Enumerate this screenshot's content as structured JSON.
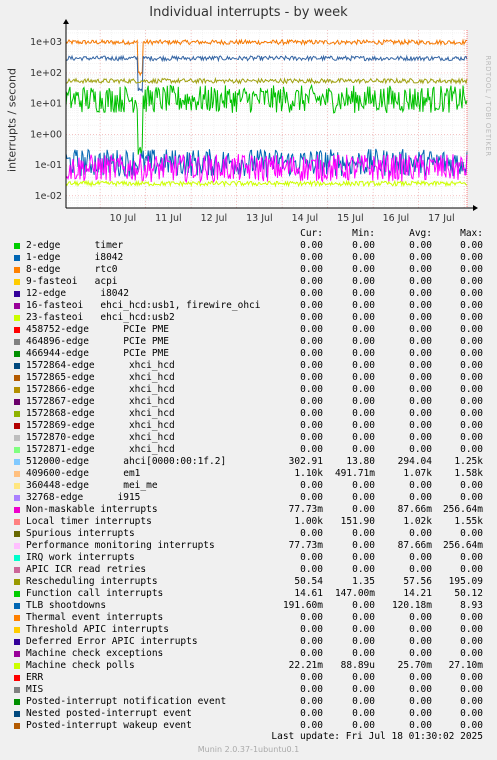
{
  "chart_data": {
    "type": "line",
    "title": "Individual interrupts - by week",
    "ylabel": "interrupts / second",
    "yscale": "log",
    "ylim": [
      0.004,
      2500
    ],
    "yticks": [
      "1e+03",
      "1e+02",
      "1e+01",
      "1e+00",
      "1e-01",
      "1e-02"
    ],
    "ytick_values": [
      1000,
      100,
      10,
      1,
      0.1,
      0.01
    ],
    "xticks": [
      "10 Jul",
      "11 Jul",
      "12 Jul",
      "13 Jul",
      "14 Jul",
      "15 Jul",
      "16 Jul",
      "17 Jul"
    ],
    "xlim": [
      "2025-07-09 06:00",
      "2025-07-18 01:30"
    ],
    "grid": true,
    "series": [
      {
        "name": "Local timer interrupts",
        "color": "#f57900",
        "approx_level": 1000,
        "gap_start": "2025-07-10 20:00",
        "gap_end": "2025-07-10 22:30",
        "gap_level": 100
      },
      {
        "name": "512000-edge ahci[0000:00:1f.2]",
        "color": "#3465a4",
        "approx_level": 300,
        "gap_start": "2025-07-10 20:00",
        "gap_end": "2025-07-10 22:30",
        "gap_level": 30
      },
      {
        "name": "Rescheduling interrupts",
        "color": "#a0a010",
        "approx_level": 55
      },
      {
        "name": "Function call interrupts",
        "color": "#00c000",
        "approx_level": 14,
        "dip_level": 0.4
      },
      {
        "name": "TLB shootdowns",
        "color": "#0066b3",
        "approx_level": 0.12
      },
      {
        "name": "Non-maskable interrupts",
        "color": "#ff00ff",
        "approx_level": 0.08
      },
      {
        "name": "Machine check polls",
        "color": "#ccff00",
        "approx_level": 0.025
      }
    ]
  },
  "side_note": "RRDTOOL / TOBI OETIKER",
  "legend": {
    "headers": [
      "Cur:",
      "Min:",
      "Avg:",
      "Max:"
    ],
    "rows": [
      {
        "label": "2-edge      timer",
        "color": "#00cc00",
        "cur": "0.00",
        "min": "0.00",
        "avg": "0.00",
        "max": "0.00"
      },
      {
        "label": "1-edge      i8042",
        "color": "#0066b3",
        "cur": "0.00",
        "min": "0.00",
        "avg": "0.00",
        "max": "0.00"
      },
      {
        "label": "8-edge      rtc0",
        "color": "#ff8000",
        "cur": "0.00",
        "min": "0.00",
        "avg": "0.00",
        "max": "0.00"
      },
      {
        "label": "9-fasteoi   acpi",
        "color": "#ffcc00",
        "cur": "0.00",
        "min": "0.00",
        "avg": "0.00",
        "max": "0.00"
      },
      {
        "label": "12-edge      i8042",
        "color": "#330099",
        "cur": "0.00",
        "min": "0.00",
        "avg": "0.00",
        "max": "0.00"
      },
      {
        "label": "16-fasteoi   ehci_hcd:usb1, firewire_ohci",
        "color": "#990099",
        "cur": "0.00",
        "min": "0.00",
        "avg": "0.00",
        "max": "0.00"
      },
      {
        "label": "23-fasteoi   ehci_hcd:usb2",
        "color": "#ccff00",
        "cur": "0.00",
        "min": "0.00",
        "avg": "0.00",
        "max": "0.00"
      },
      {
        "label": "458752-edge      PCIe PME",
        "color": "#ff0000",
        "cur": "0.00",
        "min": "0.00",
        "avg": "0.00",
        "max": "0.00"
      },
      {
        "label": "464896-edge      PCIe PME",
        "color": "#808080",
        "cur": "0.00",
        "min": "0.00",
        "avg": "0.00",
        "max": "0.00"
      },
      {
        "label": "466944-edge      PCIe PME",
        "color": "#008f00",
        "cur": "0.00",
        "min": "0.00",
        "avg": "0.00",
        "max": "0.00"
      },
      {
        "label": "1572864-edge      xhci_hcd",
        "color": "#00487d",
        "cur": "0.00",
        "min": "0.00",
        "avg": "0.00",
        "max": "0.00"
      },
      {
        "label": "1572865-edge      xhci_hcd",
        "color": "#b35a00",
        "cur": "0.00",
        "min": "0.00",
        "avg": "0.00",
        "max": "0.00"
      },
      {
        "label": "1572866-edge      xhci_hcd",
        "color": "#b38f00",
        "cur": "0.00",
        "min": "0.00",
        "avg": "0.00",
        "max": "0.00"
      },
      {
        "label": "1572867-edge      xhci_hcd",
        "color": "#6b006b",
        "cur": "0.00",
        "min": "0.00",
        "avg": "0.00",
        "max": "0.00"
      },
      {
        "label": "1572868-edge      xhci_hcd",
        "color": "#8fb300",
        "cur": "0.00",
        "min": "0.00",
        "avg": "0.00",
        "max": "0.00"
      },
      {
        "label": "1572869-edge      xhci_hcd",
        "color": "#b30000",
        "cur": "0.00",
        "min": "0.00",
        "avg": "0.00",
        "max": "0.00"
      },
      {
        "label": "1572870-edge      xhci_hcd",
        "color": "#bebebe",
        "cur": "0.00",
        "min": "0.00",
        "avg": "0.00",
        "max": "0.00"
      },
      {
        "label": "1572871-edge      xhci_hcd",
        "color": "#80ff80",
        "cur": "0.00",
        "min": "0.00",
        "avg": "0.00",
        "max": "0.00"
      },
      {
        "label": "512000-edge      ahci[0000:00:1f.2]",
        "color": "#80c9ff",
        "cur": "302.91",
        "min": "13.80",
        "avg": "294.04",
        "max": "1.25k"
      },
      {
        "label": "409600-edge      em1",
        "color": "#ffc080",
        "cur": "1.10k",
        "min": "491.71m",
        "avg": "1.07k",
        "max": "1.58k"
      },
      {
        "label": "360448-edge      mei_me",
        "color": "#ffe680",
        "cur": "0.00",
        "min": "0.00",
        "avg": "0.00",
        "max": "0.00"
      },
      {
        "label": "32768-edge      i915",
        "color": "#aa80ff",
        "cur": "0.00",
        "min": "0.00",
        "avg": "0.00",
        "max": "0.00"
      },
      {
        "label": "Non-maskable interrupts",
        "color": "#ee00cc",
        "cur": "77.73m",
        "min": "0.00",
        "avg": "87.66m",
        "max": "256.64m"
      },
      {
        "label": "Local timer interrupts",
        "color": "#ff8080",
        "cur": "1.00k",
        "min": "151.90",
        "avg": "1.02k",
        "max": "1.55k"
      },
      {
        "label": "Spurious interrupts",
        "color": "#666600",
        "cur": "0.00",
        "min": "0.00",
        "avg": "0.00",
        "max": "0.00"
      },
      {
        "label": "Performance monitoring interrupts",
        "color": "#ffbfff",
        "cur": "77.73m",
        "min": "0.00",
        "avg": "87.66m",
        "max": "256.64m"
      },
      {
        "label": "IRQ work interrupts",
        "color": "#00ffcc",
        "cur": "0.00",
        "min": "0.00",
        "avg": "0.00",
        "max": "0.00"
      },
      {
        "label": "APIC ICR read retries",
        "color": "#cc6699",
        "cur": "0.00",
        "min": "0.00",
        "avg": "0.00",
        "max": "0.00"
      },
      {
        "label": "Rescheduling interrupts",
        "color": "#999900",
        "cur": "50.54",
        "min": "1.35",
        "avg": "57.56",
        "max": "195.09"
      },
      {
        "label": "Function call interrupts",
        "color": "#00cc00",
        "cur": "14.61",
        "min": "147.00m",
        "avg": "14.21",
        "max": "50.12"
      },
      {
        "label": "TLB shootdowns",
        "color": "#0066b3",
        "cur": "191.60m",
        "min": "0.00",
        "avg": "120.18m",
        "max": "8.93"
      },
      {
        "label": "Thermal event interrupts",
        "color": "#ff8000",
        "cur": "0.00",
        "min": "0.00",
        "avg": "0.00",
        "max": "0.00"
      },
      {
        "label": "Threshold APIC interrupts",
        "color": "#ffcc00",
        "cur": "0.00",
        "min": "0.00",
        "avg": "0.00",
        "max": "0.00"
      },
      {
        "label": "Deferred Error APIC interrupts",
        "color": "#330099",
        "cur": "0.00",
        "min": "0.00",
        "avg": "0.00",
        "max": "0.00"
      },
      {
        "label": "Machine check exceptions",
        "color": "#990099",
        "cur": "0.00",
        "min": "0.00",
        "avg": "0.00",
        "max": "0.00"
      },
      {
        "label": "Machine check polls",
        "color": "#ccff00",
        "cur": "22.21m",
        "min": "88.89u",
        "avg": "25.70m",
        "max": "27.10m"
      },
      {
        "label": "ERR",
        "color": "#ff0000",
        "cur": "0.00",
        "min": "0.00",
        "avg": "0.00",
        "max": "0.00"
      },
      {
        "label": "MIS",
        "color": "#808080",
        "cur": "0.00",
        "min": "0.00",
        "avg": "0.00",
        "max": "0.00"
      },
      {
        "label": "Posted-interrupt notification event",
        "color": "#008f00",
        "cur": "0.00",
        "min": "0.00",
        "avg": "0.00",
        "max": "0.00"
      },
      {
        "label": "Nested posted-interrupt event",
        "color": "#00487d",
        "cur": "0.00",
        "min": "0.00",
        "avg": "0.00",
        "max": "0.00"
      },
      {
        "label": "Posted-interrupt wakeup event",
        "color": "#b35a00",
        "cur": "0.00",
        "min": "0.00",
        "avg": "0.00",
        "max": "0.00"
      }
    ]
  },
  "last_update": "Last update: Fri Jul 18 01:30:02 2025",
  "footer": "Munin 2.0.37-1ubuntu0.1"
}
